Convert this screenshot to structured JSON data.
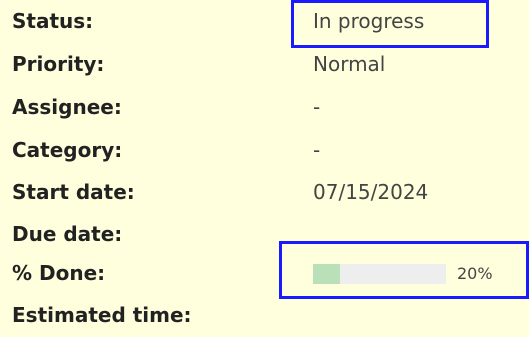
{
  "attributes": {
    "status": {
      "label": "Status:",
      "value": "In progress"
    },
    "priority": {
      "label": "Priority:",
      "value": "Normal"
    },
    "assignee": {
      "label": "Assignee:",
      "value": "-"
    },
    "category": {
      "label": "Category:",
      "value": "-"
    },
    "start_date": {
      "label": "Start date:",
      "value": "07/15/2024"
    },
    "due_date": {
      "label": "Due date:",
      "value": ""
    },
    "done": {
      "label": "% Done:",
      "value": "20%",
      "fraction": 0.2
    },
    "estimated_time": {
      "label": "Estimated time:",
      "value": ""
    }
  },
  "colors": {
    "background": "#ffffdd",
    "highlight_border": "#1a1aff",
    "progress_fill": "#bae0ba",
    "progress_track": "#eeeeee"
  }
}
